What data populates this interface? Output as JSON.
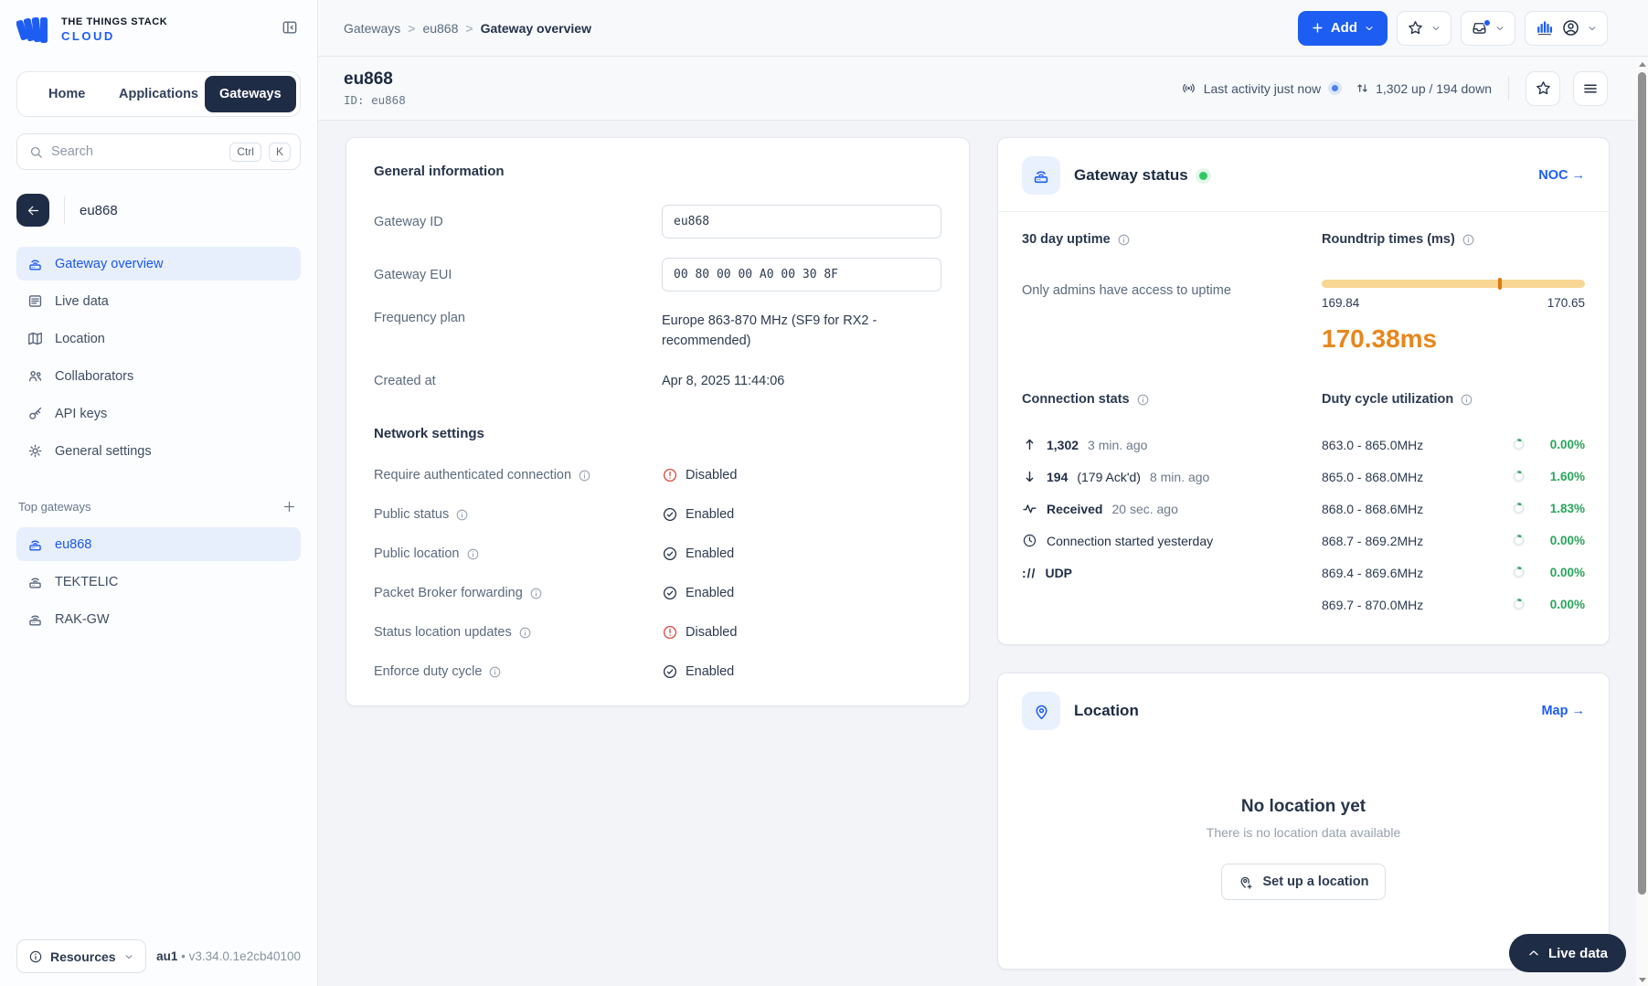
{
  "brand": {
    "name_top": "THE THINGS STACK",
    "name_bottom": "CLOUD"
  },
  "nav_tabs": {
    "home": "Home",
    "applications": "Applications",
    "gateways": "Gateways"
  },
  "search": {
    "placeholder": "Search",
    "kbd_ctrl": "Ctrl",
    "kbd_k": "K"
  },
  "entity": {
    "name": "eu868"
  },
  "sidebar_menu": {
    "items": [
      {
        "label": "Gateway overview"
      },
      {
        "label": "Live data"
      },
      {
        "label": "Location"
      },
      {
        "label": "Collaborators"
      },
      {
        "label": "API keys"
      },
      {
        "label": "General settings"
      }
    ],
    "top_gateways_label": "Top gateways",
    "gateways": [
      {
        "label": "eu868"
      },
      {
        "label": "TEKTELIC"
      },
      {
        "label": "RAK-GW"
      }
    ]
  },
  "sidebar_footer": {
    "resources_label": "Resources",
    "cluster": "au1",
    "separator": "•",
    "version": "v3.34.0.1e2cb40100"
  },
  "breadcrumb": {
    "level1": "Gateways",
    "level2": "eu868",
    "level3": "Gateway overview",
    "sep": ">"
  },
  "header_actions": {
    "add_label": "Add"
  },
  "page_header": {
    "title": "eu868",
    "id_line": "ID: eu868",
    "last_activity": "Last activity just now",
    "traffic": "1,302 up / 194 down"
  },
  "general_info": {
    "section_title": "General information",
    "gateway_id_label": "Gateway ID",
    "gateway_id_value": "eu868",
    "gateway_eui_label": "Gateway EUI",
    "gateway_eui_value": "00 80 00 00 A0 00 30 8F",
    "frequency_plan_label": "Frequency plan",
    "frequency_plan_value": "Europe 863-870 MHz (SF9 for RX2 - recommended)",
    "created_at_label": "Created at",
    "created_at_value": "Apr 8, 2025 11:44:06"
  },
  "network_settings": {
    "section_title": "Network settings",
    "rows": [
      {
        "label": "Require authenticated connection",
        "status": "Disabled"
      },
      {
        "label": "Public status",
        "status": "Enabled"
      },
      {
        "label": "Public location",
        "status": "Enabled"
      },
      {
        "label": "Packet Broker forwarding",
        "status": "Enabled"
      },
      {
        "label": "Status location updates",
        "status": "Disabled"
      },
      {
        "label": "Enforce duty cycle",
        "status": "Enabled"
      }
    ]
  },
  "gateway_status": {
    "title": "Gateway status",
    "noc_link": "NOC →",
    "uptime_title": "30 day uptime",
    "uptime_note": "Only admins have access to uptime",
    "roundtrip_title": "Roundtrip times (ms)",
    "roundtrip_min": "169.84",
    "roundtrip_max": "170.65",
    "roundtrip_current": "170.38ms",
    "connection_title": "Connection stats",
    "uplink_count": "1,302",
    "uplink_time": "3 min. ago",
    "downlink_count": "194",
    "downlink_ack": "(179 Ack'd)",
    "downlink_time": "8 min. ago",
    "received_label": "Received",
    "received_time": "20 sec. ago",
    "connection_started": "Connection started yesterday",
    "protocol_icon": "://",
    "protocol": "UDP",
    "duty_title": "Duty cycle utilization",
    "duty_rows": [
      {
        "band": "863.0 - 865.0MHz",
        "value": "0.00%"
      },
      {
        "band": "865.0 - 868.0MHz",
        "value": "1.60%"
      },
      {
        "band": "868.0 - 868.6MHz",
        "value": "1.83%"
      },
      {
        "band": "868.7 - 869.2MHz",
        "value": "0.00%"
      },
      {
        "band": "869.4 - 869.6MHz",
        "value": "0.00%"
      },
      {
        "band": "869.7 - 870.0MHz",
        "value": "0.00%"
      }
    ]
  },
  "location_panel": {
    "title": "Location",
    "map_link": "Map →",
    "empty_title": "No location yet",
    "empty_subtitle": "There is no location data available",
    "setup_button": "Set up a location"
  },
  "live_data_button": {
    "label": "Live data"
  },
  "colors": {
    "primary": "#1d5df2",
    "navy": "#1f2c45",
    "green": "#27a65a",
    "red": "#d8473c",
    "orange": "#e8861b"
  }
}
